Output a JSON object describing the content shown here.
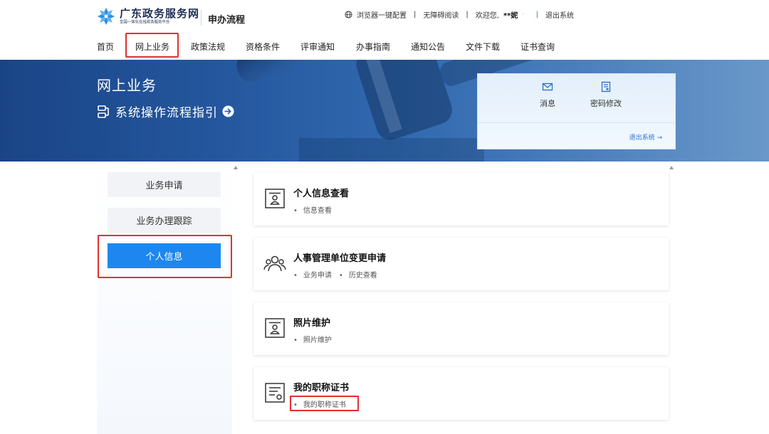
{
  "header": {
    "logo_title": "广东政务服务网",
    "logo_subtitle": "全国一体化在线政务服务平台",
    "product_name": "申办流程",
    "browser_config": "浏览器一键配置",
    "accessibility": "无障碍阅读",
    "welcome": "欢迎您,",
    "user_name": "**妮",
    "logout": "退出系统"
  },
  "nav": {
    "items": [
      {
        "label": "首页"
      },
      {
        "label": "网上业务"
      },
      {
        "label": "政策法规"
      },
      {
        "label": "资格条件"
      },
      {
        "label": "评审通知"
      },
      {
        "label": "办事指南"
      },
      {
        "label": "通知公告"
      },
      {
        "label": "文件下载"
      },
      {
        "label": "证书查询"
      }
    ],
    "active_index": 1
  },
  "banner": {
    "title": "网上业务",
    "guide": "系统操作流程指引"
  },
  "user_panel": {
    "messages": "消息",
    "password": "密码修改",
    "logout": "退出系统 →"
  },
  "sidebar": {
    "items": [
      {
        "label": "业务申请"
      },
      {
        "label": "业务办理跟踪"
      },
      {
        "label": "个人信息"
      }
    ],
    "active_index": 2
  },
  "cards": [
    {
      "title": "个人信息查看",
      "icon": "id-card-icon",
      "links": [
        "信息查看"
      ]
    },
    {
      "title": "人事管理单位变更申请",
      "icon": "people-icon",
      "links": [
        "业务申请",
        "历史查看"
      ]
    },
    {
      "title": "照片维护",
      "icon": "photo-id-icon",
      "links": [
        "照片维护"
      ]
    },
    {
      "title": "我的职称证书",
      "icon": "certificate-icon",
      "links": [
        "我的职称证书"
      ]
    }
  ],
  "colors": {
    "accent": "#1e87ef",
    "highlight": "#e3302f",
    "banner": "#2a62ad"
  }
}
